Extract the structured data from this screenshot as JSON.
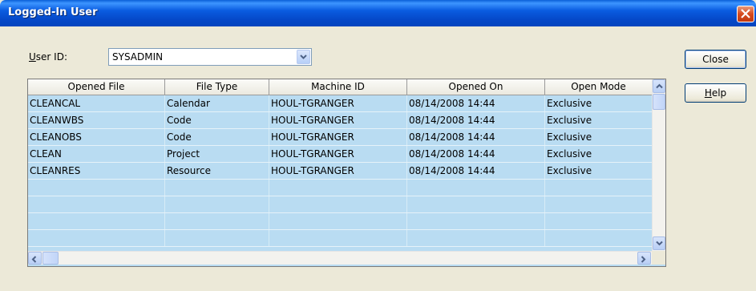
{
  "window": {
    "title": "Logged-In User"
  },
  "user_id": {
    "label_accel": "U",
    "label_rest": "ser ID:",
    "value": "SYSADMIN"
  },
  "table": {
    "columns": [
      "Opened File",
      "File Type",
      "Machine ID",
      "Opened On",
      "Open Mode"
    ],
    "rows": [
      [
        "CLEANCAL",
        "Calendar",
        "HOUL-TGRANGER",
        "08/14/2008 14:44",
        "Exclusive"
      ],
      [
        "CLEANWBS",
        "Code",
        "HOUL-TGRANGER",
        "08/14/2008 14:44",
        "Exclusive"
      ],
      [
        "CLEANOBS",
        "Code",
        "HOUL-TGRANGER",
        "08/14/2008 14:44",
        "Exclusive"
      ],
      [
        "CLEAN",
        "Project",
        "HOUL-TGRANGER",
        "08/14/2008 14:44",
        "Exclusive"
      ],
      [
        "CLEANRES",
        "Resource",
        "HOUL-TGRANGER",
        "08/14/2008 14:44",
        "Exclusive"
      ]
    ]
  },
  "buttons": {
    "close_label": "Close",
    "help_accel": "H",
    "help_rest": "elp"
  },
  "colors": {
    "title_bar": "#0548c8",
    "grid_background": "#b9dcf2",
    "dialog_background": "#ece9d8"
  }
}
